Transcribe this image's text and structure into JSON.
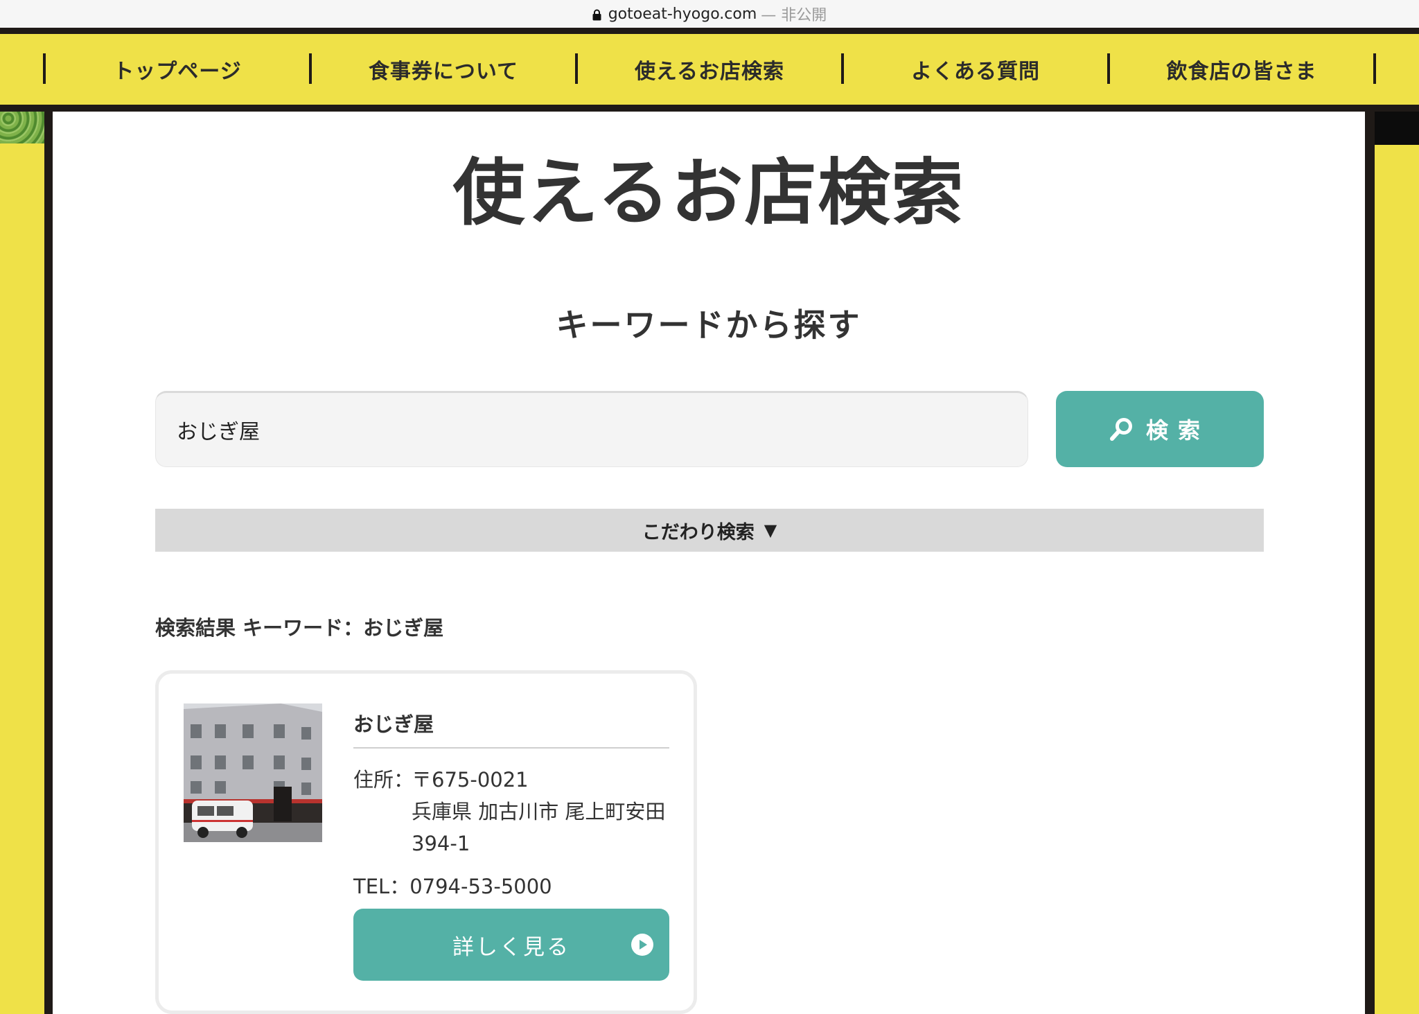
{
  "browser": {
    "url": "gotoeat-hyogo.com",
    "status": "— 非公開"
  },
  "nav": {
    "items": [
      {
        "label": "トップページ"
      },
      {
        "label": "食事券について"
      },
      {
        "label": "使えるお店検索"
      },
      {
        "label": "よくある質問"
      },
      {
        "label": "飲食店の皆さま"
      }
    ]
  },
  "page": {
    "title": "使えるお店検索",
    "section_title": "キーワードから探す"
  },
  "search": {
    "value": "おじぎ屋",
    "button_label": "検索"
  },
  "filter": {
    "label": "こだわり検索",
    "arrow": "▼"
  },
  "results": {
    "heading": "検索結果 キーワード：おじぎ屋",
    "items": [
      {
        "name": "おじぎ屋",
        "address_label": "住所：",
        "zip": "〒675-0021",
        "address_line1": "兵庫県 加古川市 尾上町安田",
        "address_line2": "394-1",
        "tel": "TEL：0794-53-5000",
        "detail_label": "詳しく見る"
      }
    ]
  },
  "colors": {
    "accent_yellow": "#efe148",
    "accent_teal": "#54b1a6",
    "frame_dark": "#1f1a17"
  },
  "icons": [
    "lock-icon",
    "search-icon",
    "play-icon"
  ]
}
